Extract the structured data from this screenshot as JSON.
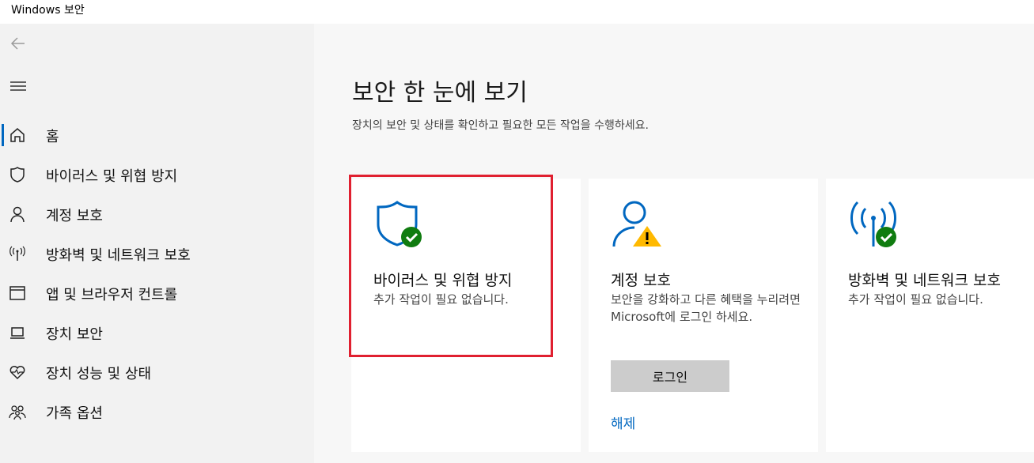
{
  "window": {
    "title": "Windows 보안"
  },
  "colors": {
    "accent": "#0067c0",
    "ok": "#107c10",
    "warning": "#ffb900",
    "highlight": "#e02030",
    "sidebar_bg": "#f2f2f2",
    "main_bg": "#f7f7f7"
  },
  "sidebar": {
    "back_icon": "arrow-left-icon",
    "menu_icon": "hamburger-icon",
    "items": [
      {
        "label": "홈",
        "icon": "home-icon",
        "active": true
      },
      {
        "label": "바이러스 및 위협 방지",
        "icon": "shield-icon"
      },
      {
        "label": "계정 보호",
        "icon": "person-icon"
      },
      {
        "label": "방화벽 및 네트워크 보호",
        "icon": "antenna-icon"
      },
      {
        "label": "앱 및 브라우저 컨트롤",
        "icon": "browser-window-icon"
      },
      {
        "label": "장치 보안",
        "icon": "laptop-icon"
      },
      {
        "label": "장치 성능 및 상태",
        "icon": "heart-pulse-icon"
      },
      {
        "label": "가족 옵션",
        "icon": "family-icon"
      }
    ]
  },
  "main": {
    "title": "보안 한 눈에 보기",
    "subtitle": "장치의 보안 및 상태를 확인하고 필요한 모든 작업을 수행하세요.",
    "cards": [
      {
        "title": "바이러스 및 위협 방지",
        "description": "추가 작업이 필요 없습니다.",
        "icon": "shield-check-icon",
        "status": "ok"
      },
      {
        "title": "계정 보호",
        "description": "보안을 강화하고 다른 혜택을 누리려면 Microsoft에 로그인 하세요.",
        "icon": "person-warning-icon",
        "status": "warning",
        "button_label": "로그인",
        "link_label": "해제"
      },
      {
        "title": "방화벽 및 네트워크 보호",
        "description": "추가 작업이 필요 없습니다.",
        "icon": "antenna-check-icon",
        "status": "ok"
      }
    ]
  }
}
